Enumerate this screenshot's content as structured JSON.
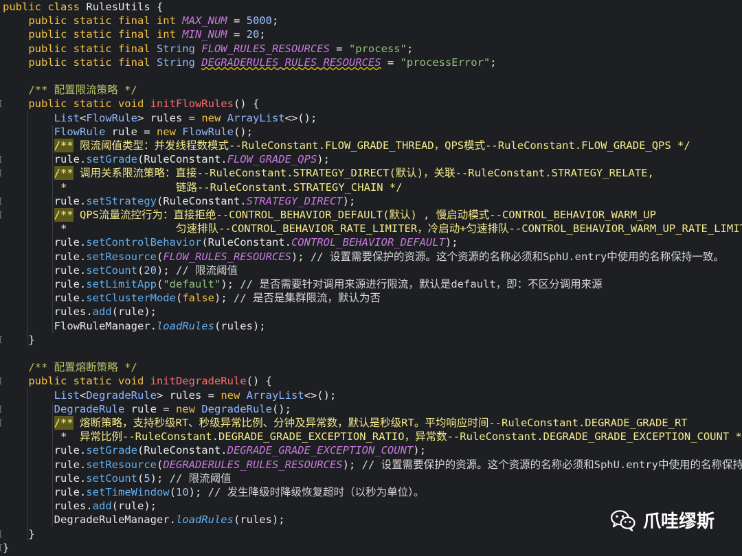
{
  "code": {
    "lines": [
      [
        [
          "kw",
          "public class "
        ],
        [
          "plain",
          "RulesUtils {"
        ]
      ],
      [
        [
          "kw",
          "    public static final int "
        ],
        [
          "const",
          "MAX_NUM"
        ],
        [
          "plain",
          " = "
        ],
        [
          "num",
          "5000"
        ],
        [
          "plain",
          ";"
        ]
      ],
      [
        [
          "kw",
          "    public static final int "
        ],
        [
          "const",
          "MIN_NUM"
        ],
        [
          "plain",
          " = "
        ],
        [
          "num",
          "20"
        ],
        [
          "plain",
          ";"
        ]
      ],
      [
        [
          "kw",
          "    public static final "
        ],
        [
          "cls",
          "String "
        ],
        [
          "const",
          "FLOW_RULES_RESOURCES"
        ],
        [
          "plain",
          " = "
        ],
        [
          "str",
          "\"process\""
        ],
        [
          "plain",
          ";"
        ]
      ],
      [
        [
          "kw",
          "    public static final "
        ],
        [
          "cls",
          "String "
        ],
        [
          "constw",
          "DEGRADERULES_RULES_RESOURCES"
        ],
        [
          "plain",
          " = "
        ],
        [
          "str",
          "\"processError\""
        ],
        [
          "plain",
          ";"
        ]
      ],
      [],
      [
        [
          "comment",
          "    /** 配置限流策略 */"
        ]
      ],
      [
        [
          "kw",
          "    public static void "
        ],
        [
          "method",
          "initFlowRules"
        ],
        [
          "plain",
          "() {"
        ]
      ],
      [
        [
          "cls",
          "        List"
        ],
        [
          "plain",
          "<"
        ],
        [
          "cls",
          "FlowRule"
        ],
        [
          "plain",
          "> rules = "
        ],
        [
          "kw",
          "new "
        ],
        [
          "cls",
          "ArrayList"
        ],
        [
          "plain",
          "<>();"
        ]
      ],
      [
        [
          "cls",
          "        FlowRule"
        ],
        [
          "plain",
          " rule = "
        ],
        [
          "kw",
          "new "
        ],
        [
          "cls",
          "FlowRule"
        ],
        [
          "plain",
          "();"
        ]
      ],
      [
        [
          "plain",
          "        "
        ],
        [
          "hl",
          "/**"
        ],
        [
          "doc",
          " 限流阈值类型：并发线程数模式--RuleConstant.FLOW_GRADE_THREAD，QPS模式--RuleConstant.FLOW_GRADE_QPS */"
        ]
      ],
      [
        [
          "plain",
          "        rule."
        ],
        [
          "call",
          "setGrade"
        ],
        [
          "plain",
          "(RuleConstant."
        ],
        [
          "const",
          "FLOW_GRADE_QPS"
        ],
        [
          "plain",
          ");"
        ]
      ],
      [
        [
          "plain",
          "        "
        ],
        [
          "hl",
          "/**"
        ],
        [
          "doc",
          " 调用关系限流策略：直接--RuleConstant.STRATEGY_DIRECT(默认)，关联--RuleConstant.STRATEGY_RELATE,"
        ]
      ],
      [
        [
          "doc",
          "         *                 链路--RuleConstant.STRATEGY_CHAIN */"
        ]
      ],
      [
        [
          "plain",
          "        rule."
        ],
        [
          "call",
          "setStrategy"
        ],
        [
          "plain",
          "(RuleConstant."
        ],
        [
          "const",
          "STRATEGY_DIRECT"
        ],
        [
          "plain",
          ");"
        ]
      ],
      [
        [
          "plain",
          "        "
        ],
        [
          "hl",
          "/**"
        ],
        [
          "doc",
          " QPS流量流控行为：直接拒绝--CONTROL_BEHAVIOR_DEFAULT(默认) , 慢启动模式--CONTROL_BEHAVIOR_WARM_UP"
        ]
      ],
      [
        [
          "doc",
          "         *                 匀速排队--CONTROL_BEHAVIOR_RATE_LIMITER，冷启动+匀速排队--CONTROL_BEHAVIOR_WARM_UP_RATE_LIMITER */"
        ]
      ],
      [
        [
          "plain",
          "        rule."
        ],
        [
          "call",
          "setControlBehavior"
        ],
        [
          "plain",
          "(RuleConstant."
        ],
        [
          "const",
          "CONTROL_BEHAVIOR_DEFAULT"
        ],
        [
          "plain",
          ");"
        ]
      ],
      [
        [
          "plain",
          "        rule."
        ],
        [
          "call",
          "setResource"
        ],
        [
          "plain",
          "("
        ],
        [
          "const",
          "FLOW_RULES_RESOURCES"
        ],
        [
          "plain",
          "); "
        ],
        [
          "cm2",
          "// 设置需要保护的资源。这个资源的名称必须和SphU.entry中使用的名称保持一致。"
        ]
      ],
      [
        [
          "plain",
          "        rule."
        ],
        [
          "call",
          "setCount"
        ],
        [
          "plain",
          "("
        ],
        [
          "num",
          "20"
        ],
        [
          "plain",
          "); "
        ],
        [
          "cm2",
          "// 限流阈值"
        ]
      ],
      [
        [
          "plain",
          "        rule."
        ],
        [
          "call",
          "setLimitApp"
        ],
        [
          "plain",
          "("
        ],
        [
          "str",
          "\"default\""
        ],
        [
          "plain",
          "); "
        ],
        [
          "cm2",
          "// 是否需要针对调用来源进行限流，默认是default，即：不区分调用来源"
        ]
      ],
      [
        [
          "plain",
          "        rule."
        ],
        [
          "call",
          "setClusterMode"
        ],
        [
          "plain",
          "("
        ],
        [
          "kw",
          "false"
        ],
        [
          "plain",
          "); "
        ],
        [
          "cm2",
          "// 是否是集群限流，默认为否"
        ]
      ],
      [
        [
          "plain",
          "        rules."
        ],
        [
          "call",
          "add"
        ],
        [
          "plain",
          "(rule);"
        ]
      ],
      [
        [
          "plain",
          "        FlowRuleManager."
        ],
        [
          "static",
          "loadRules"
        ],
        [
          "plain",
          "(rules);"
        ]
      ],
      [
        [
          "plain",
          "    }"
        ]
      ],
      [],
      [
        [
          "comment",
          "    /** 配置熔断策略 */"
        ]
      ],
      [
        [
          "kw",
          "    public static void "
        ],
        [
          "method",
          "initDegradeRule"
        ],
        [
          "plain",
          "() {"
        ]
      ],
      [
        [
          "cls",
          "        List"
        ],
        [
          "plain",
          "<"
        ],
        [
          "cls",
          "DegradeRule"
        ],
        [
          "plain",
          "> rules = "
        ],
        [
          "kw",
          "new "
        ],
        [
          "cls",
          "ArrayList"
        ],
        [
          "plain",
          "<>();"
        ]
      ],
      [
        [
          "cls",
          "        DegradeRule"
        ],
        [
          "plain",
          " rule = "
        ],
        [
          "kw",
          "new "
        ],
        [
          "cls",
          "DegradeRule"
        ],
        [
          "plain",
          "();"
        ]
      ],
      [
        [
          "plain",
          "        "
        ],
        [
          "hl",
          "/**"
        ],
        [
          "doc",
          " 熔断策略，支持秒级RT、秒级异常比例、分钟及异常数，默认是秒级RT。平均响应时间--RuleConstant.DEGRADE_GRADE_RT"
        ]
      ],
      [
        [
          "doc",
          "         *  异常比例--RuleConstant.DEGRADE_GRADE_EXCEPTION_RATIO，异常数--RuleConstant.DEGRADE_GRADE_EXCEPTION_COUNT */"
        ]
      ],
      [
        [
          "plain",
          "        rule."
        ],
        [
          "call",
          "setGrade"
        ],
        [
          "plain",
          "(RuleConstant."
        ],
        [
          "const",
          "DEGRADE_GRADE_EXCEPTION_COUNT"
        ],
        [
          "plain",
          ");"
        ]
      ],
      [
        [
          "plain",
          "        rule."
        ],
        [
          "call",
          "setResource"
        ],
        [
          "plain",
          "("
        ],
        [
          "const",
          "DEGRADERULES_RULES_RESOURCES"
        ],
        [
          "plain",
          "); "
        ],
        [
          "cm2",
          "// 设置需要保护的资源。这个资源的名称必须和SphU.entry中使用的名称保持一致。"
        ]
      ],
      [
        [
          "plain",
          "        rule."
        ],
        [
          "call",
          "setCount"
        ],
        [
          "plain",
          "("
        ],
        [
          "num",
          "5"
        ],
        [
          "plain",
          "); "
        ],
        [
          "cm2",
          "// 限流阈值"
        ]
      ],
      [
        [
          "plain",
          "        rule."
        ],
        [
          "call",
          "setTimeWindow"
        ],
        [
          "plain",
          "("
        ],
        [
          "num",
          "10"
        ],
        [
          "plain",
          "); "
        ],
        [
          "cm2",
          "// 发生降级时降级恢复超时（以秒为单位）。"
        ]
      ],
      [
        [
          "plain",
          "        rules."
        ],
        [
          "call",
          "add"
        ],
        [
          "plain",
          "(rule);"
        ]
      ],
      [
        [
          "plain",
          "        DegradeRuleManager."
        ],
        [
          "static",
          "loadRules"
        ],
        [
          "plain",
          "(rules);"
        ]
      ],
      [
        [
          "plain",
          "    }"
        ]
      ],
      [
        [
          "plain",
          "}"
        ]
      ]
    ],
    "gutter_marks": [
      7,
      24,
      27,
      38,
      39,
      11,
      12,
      14,
      15,
      29,
      30
    ]
  },
  "watermark": {
    "icon": "wechat-icon",
    "text": "爪哇缪斯"
  }
}
